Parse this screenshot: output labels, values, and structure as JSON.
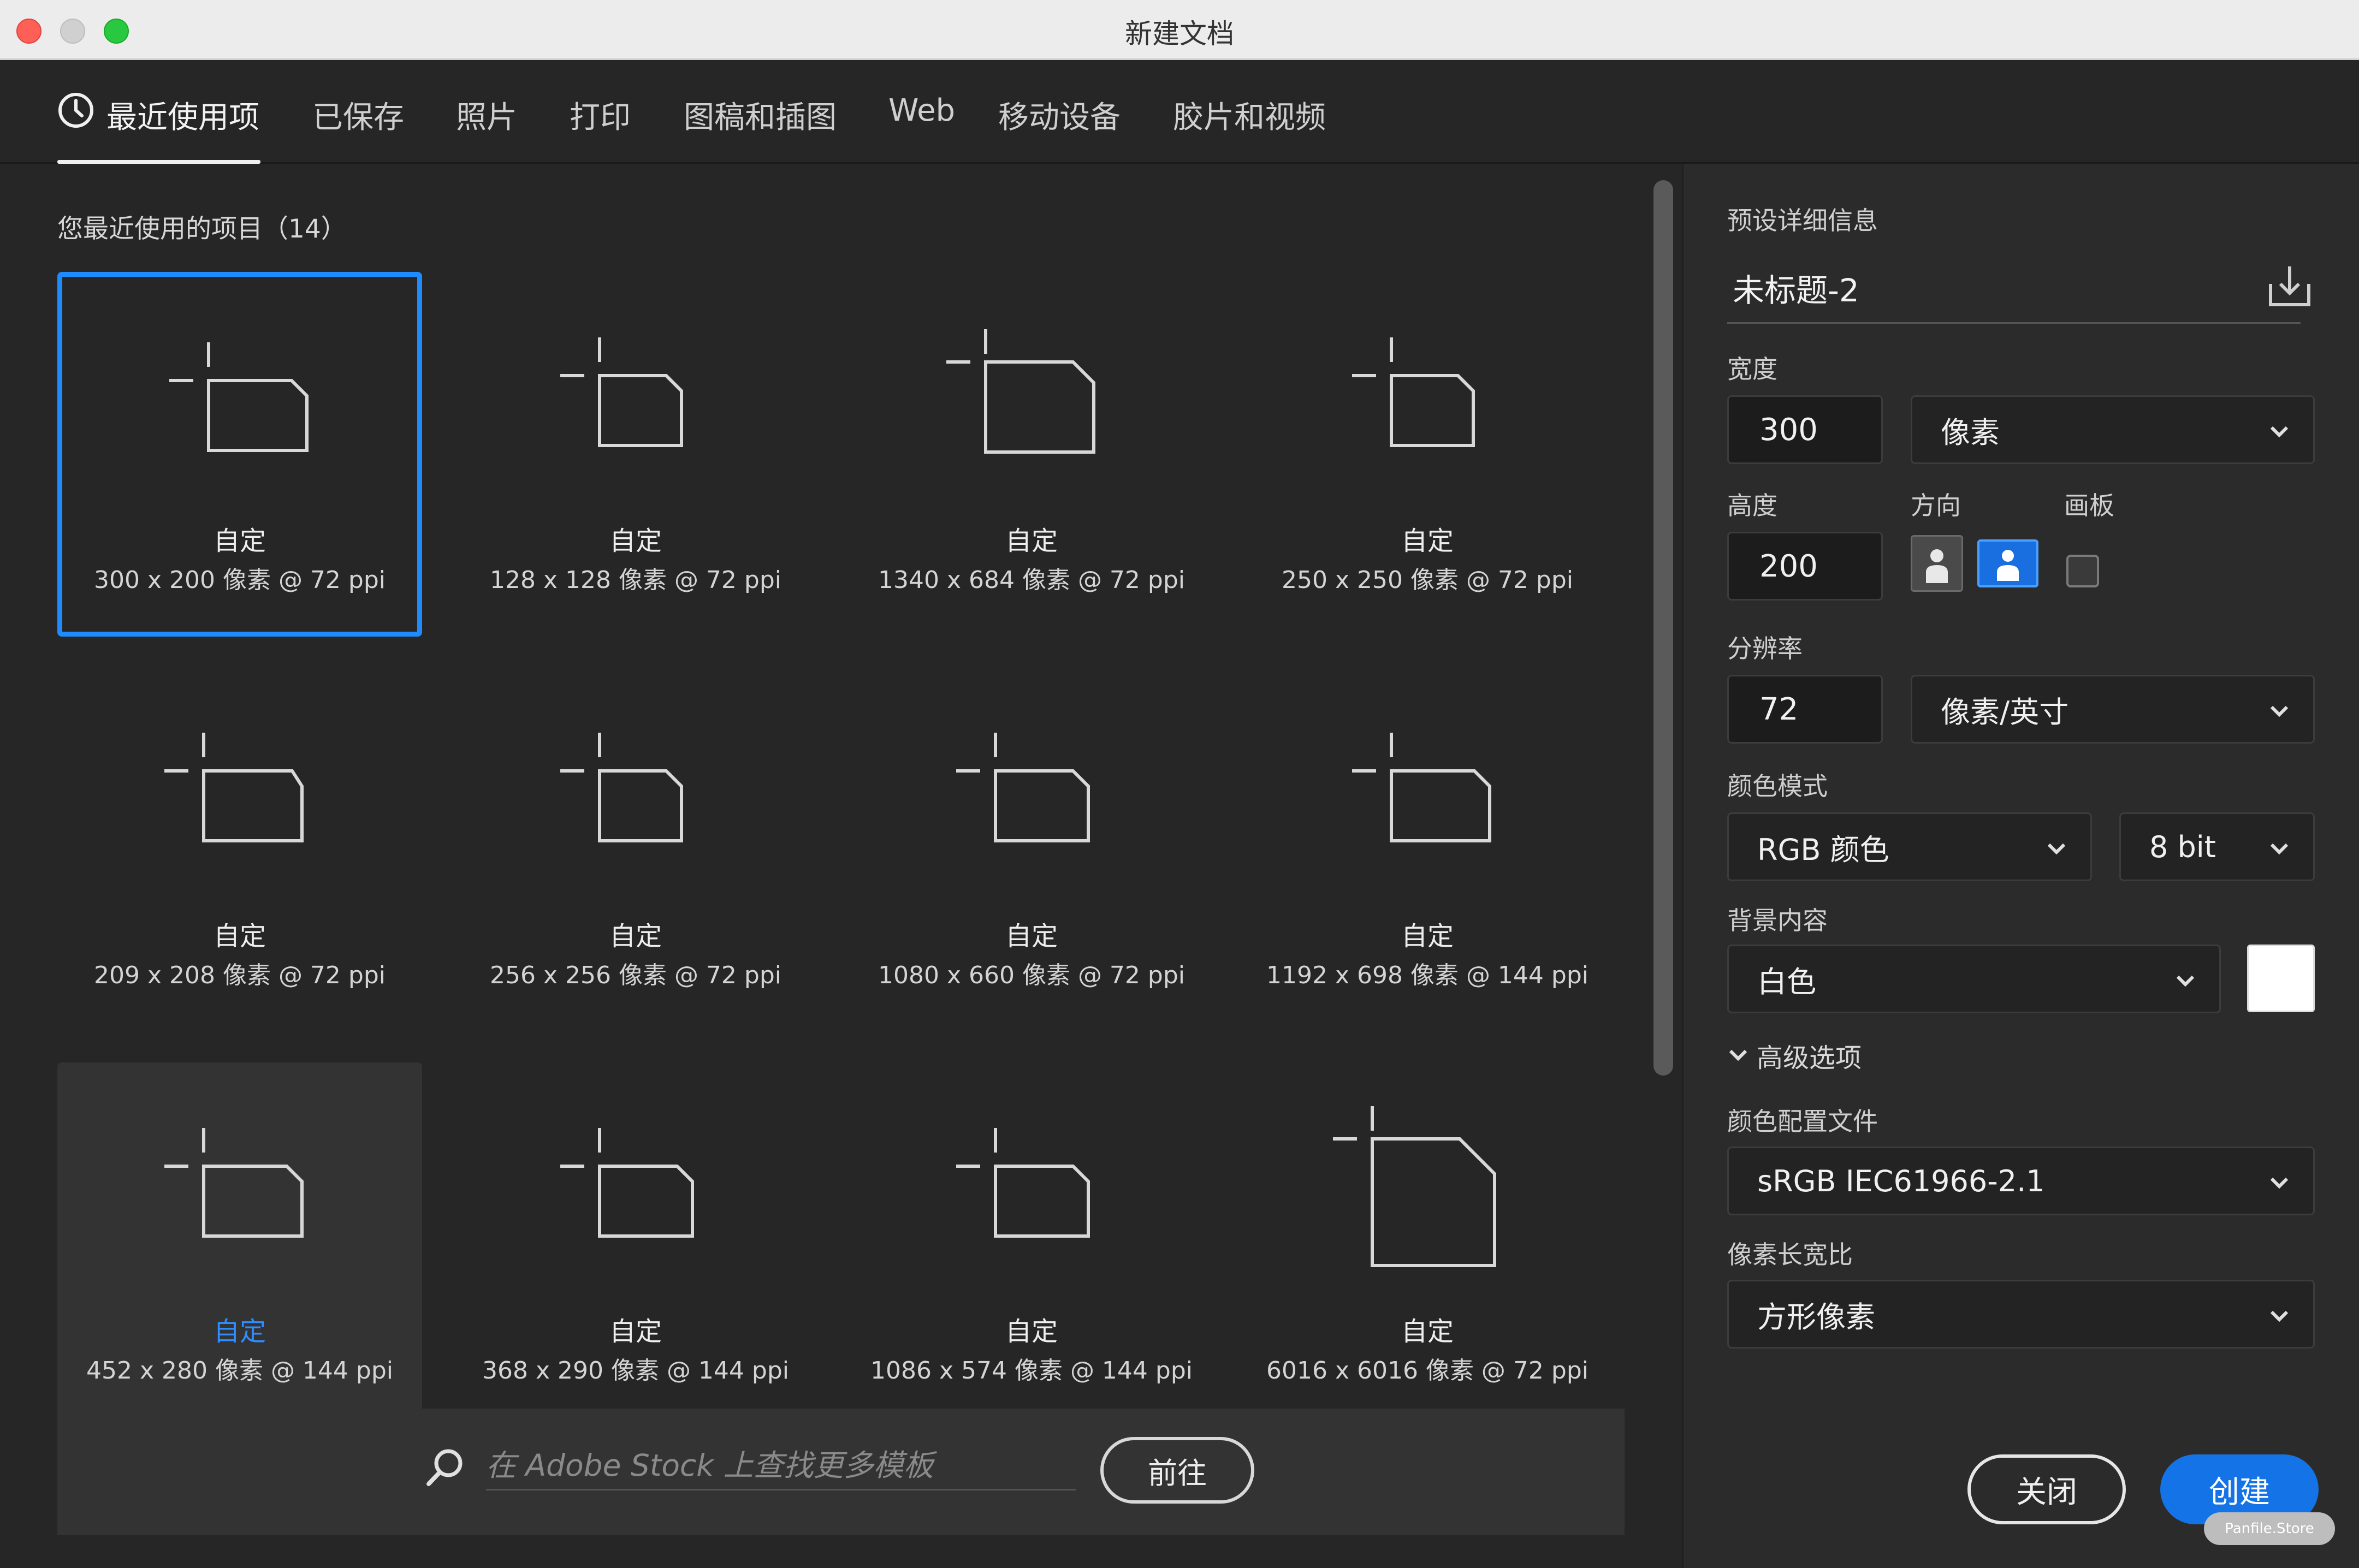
{
  "window": {
    "title": "新建文档"
  },
  "tabs": [
    {
      "label": "最近使用项"
    },
    {
      "label": "已保存"
    },
    {
      "label": "照片"
    },
    {
      "label": "打印"
    },
    {
      "label": "图稿和插图"
    },
    {
      "label": "Web"
    },
    {
      "label": "移动设备"
    },
    {
      "label": "胶片和视频"
    }
  ],
  "recent": {
    "title": "您最近使用的项目（14）",
    "items": [
      {
        "name": "自定",
        "meta": "300 x 200 像素 @ 72 ppi"
      },
      {
        "name": "自定",
        "meta": "128 x 128 像素 @ 72 ppi"
      },
      {
        "name": "自定",
        "meta": "1340 x 684 像素 @ 72 ppi"
      },
      {
        "name": "自定",
        "meta": "250 x 250 像素 @ 72 ppi"
      },
      {
        "name": "自定",
        "meta": "209 x 208 像素 @ 72 ppi"
      },
      {
        "name": "自定",
        "meta": "256 x 256 像素 @ 72 ppi"
      },
      {
        "name": "自定",
        "meta": "1080 x 660 像素 @ 72 ppi"
      },
      {
        "name": "自定",
        "meta": "1192 x 698 像素 @ 144 ppi"
      },
      {
        "name": "自定",
        "meta": "452 x 280 像素 @ 144 ppi"
      },
      {
        "name": "自定",
        "meta": "368 x 290 像素 @ 144 ppi"
      },
      {
        "name": "自定",
        "meta": "1086 x 574 像素 @ 144 ppi"
      },
      {
        "name": "自定",
        "meta": "6016 x 6016 像素 @ 72 ppi"
      }
    ]
  },
  "search": {
    "placeholder": "在 Adobe Stock 上查找更多模板",
    "go_label": "前往"
  },
  "preset": {
    "section_title": "预设详细信息",
    "doc_name": "未标题-2",
    "width_label": "宽度",
    "width_value": "300",
    "width_unit": "像素",
    "height_label": "高度",
    "height_value": "200",
    "orientation_label": "方向",
    "artboard_label": "画板",
    "resolution_label": "分辨率",
    "resolution_value": "72",
    "resolution_unit": "像素/英寸",
    "color_mode_label": "颜色模式",
    "color_mode": "RGB 颜色",
    "bit_depth": "8 bit",
    "background_label": "背景内容",
    "background": "白色",
    "background_color": "#ffffff",
    "advanced_label": "高级选项",
    "profile_label": "颜色配置文件",
    "profile": "sRGB IEC61966-2.1",
    "pixel_aspect_label": "像素长宽比",
    "pixel_aspect": "方形像素",
    "close_label": "关闭",
    "create_label": "创建"
  },
  "watermark": "Panfile.Store",
  "colors": {
    "accent": "#1473e6",
    "selection": "#1e8bff"
  }
}
